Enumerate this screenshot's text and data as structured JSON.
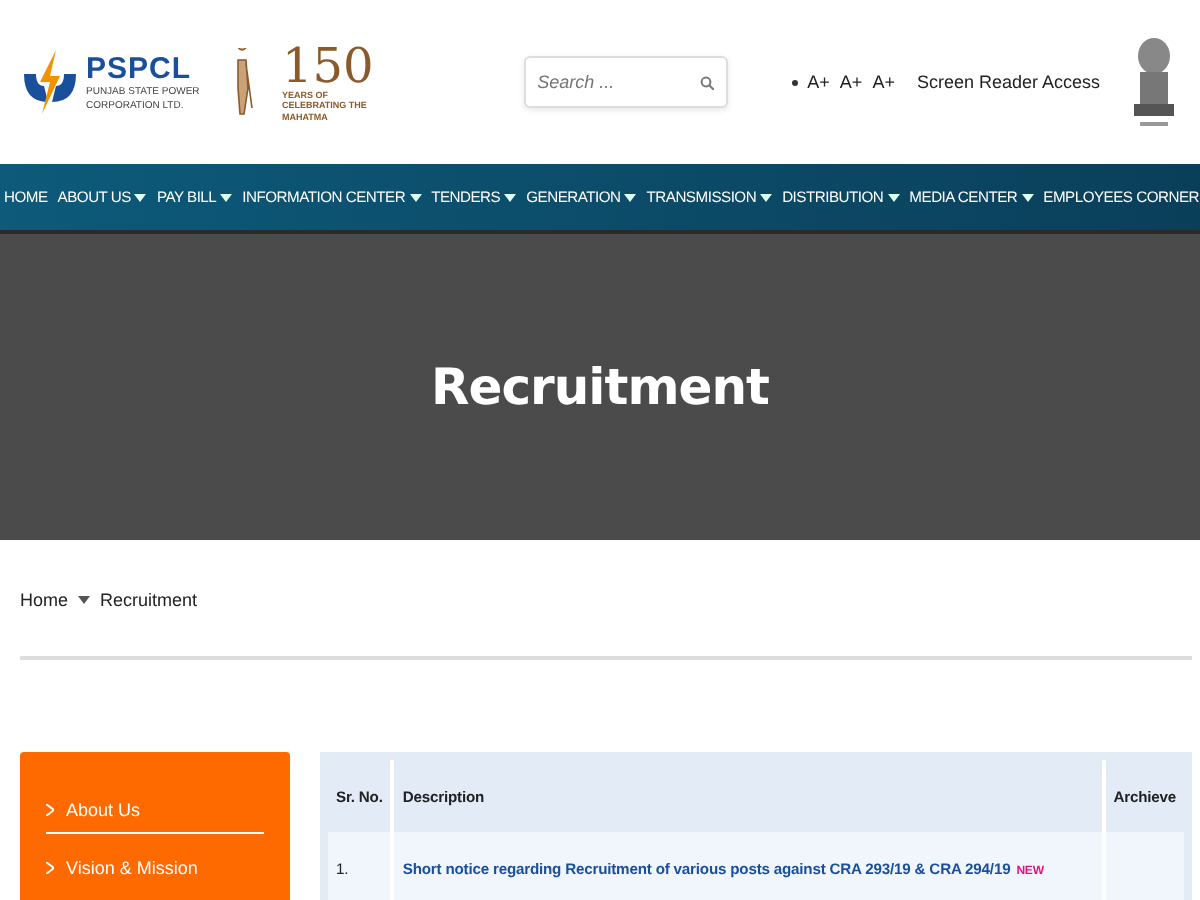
{
  "logo": {
    "name": "PSPCL",
    "subtitle": "PUNJAB STATE POWER CORPORATION LTD."
  },
  "anniversary": {
    "number": "150",
    "caption": "YEARS OF CELEBRATING THE MAHATMA"
  },
  "search": {
    "placeholder": "Search ..."
  },
  "accessibility": {
    "font_sizes": [
      "A+",
      "A+",
      "A+"
    ],
    "screen_reader": "Screen Reader Access"
  },
  "nav": [
    {
      "label": "HOME",
      "dropdown": false
    },
    {
      "label": "ABOUT US",
      "dropdown": true
    },
    {
      "label": "PAY BILL",
      "dropdown": true
    },
    {
      "label": "INFORMATION CENTER",
      "dropdown": true
    },
    {
      "label": "TENDERS",
      "dropdown": true
    },
    {
      "label": "GENERATION",
      "dropdown": true
    },
    {
      "label": "TRANSMISSION",
      "dropdown": true
    },
    {
      "label": "DISTRIBUTION",
      "dropdown": true
    },
    {
      "label": "MEDIA CENTER",
      "dropdown": true
    },
    {
      "label": "EMPLOYEES CORNER",
      "dropdown": false
    }
  ],
  "hero": {
    "title": "Recruitment"
  },
  "breadcrumb": [
    "Home",
    "Recruitment"
  ],
  "sidebar": {
    "items": [
      "About Us",
      "Vision & Mission"
    ]
  },
  "table": {
    "columns": [
      "Sr. No.",
      "Description",
      "Archieve"
    ],
    "rows": [
      {
        "sr": "1.",
        "description": "Short notice regarding Recruitment of various posts against CRA 293/19 & CRA 294/19",
        "badge": "NEW"
      }
    ]
  }
}
